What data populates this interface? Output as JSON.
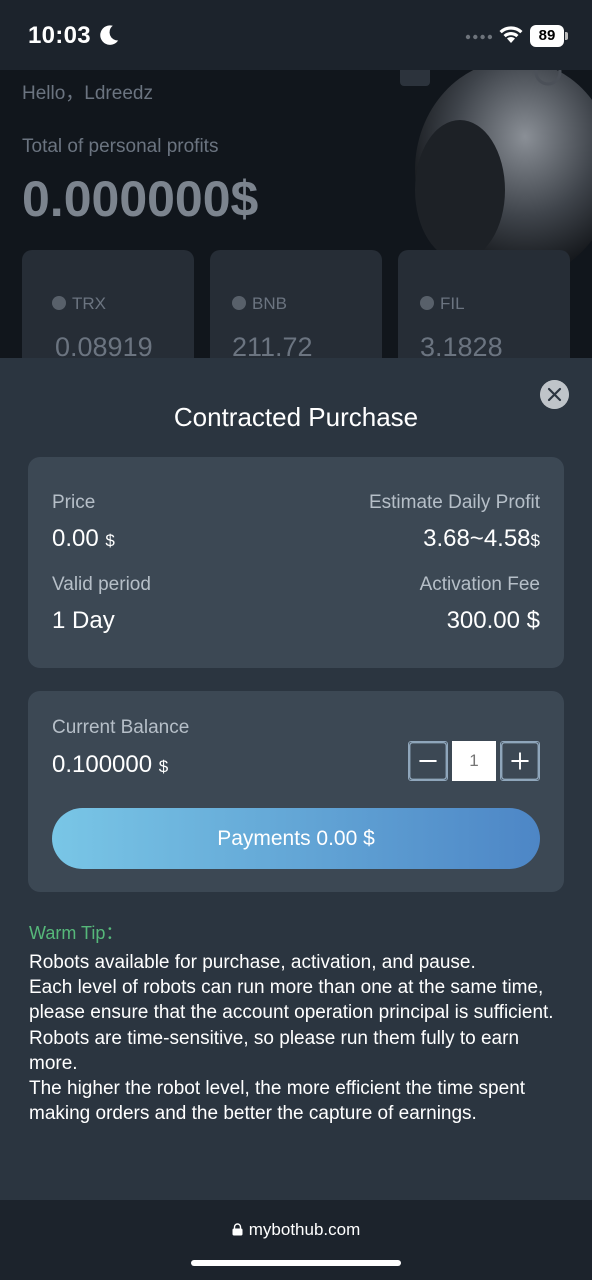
{
  "status_bar": {
    "time": "10:03",
    "battery": "89",
    "icons": [
      "moon-icon",
      "signal-dots-icon",
      "wifi-icon",
      "battery-icon"
    ]
  },
  "background_page": {
    "greeting": "Hello，Ldreedz",
    "profit_label": "Total of personal profits",
    "profit_value": "0.000000$",
    "coins": [
      {
        "name": "TRX",
        "price": "0.08919"
      },
      {
        "name": "BNB",
        "price": "211.72"
      },
      {
        "name": "FIL",
        "price": "3.1828"
      }
    ]
  },
  "modal": {
    "title": "Contracted Purchase",
    "price_label": "Price",
    "price_value": "0.00",
    "price_unit": "$",
    "daily_profit_label": "Estimate Daily Profit",
    "daily_profit_value": "3.68~4.58",
    "daily_profit_unit": "$",
    "valid_period_label": "Valid period",
    "valid_period_value": "1 Day",
    "activation_fee_label": "Activation Fee",
    "activation_fee_value": "300.00 $",
    "balance_label": "Current Balance",
    "balance_value": "0.100000",
    "balance_unit": "$",
    "quantity_placeholder": "1",
    "payment_button": "Payments 0.00 $",
    "tip_title": "Warm Tip：",
    "tip_lines": [
      "Robots available for purchase, activation, and pause.",
      "Each level of robots can run more than one at the same time, please ensure that the account operation principal is sufficient.",
      "Robots are time-sensitive, so please run them fully to earn more.",
      "The higher the robot level, the more efficient the time spent making orders and the better the capture of earnings."
    ]
  },
  "browser": {
    "url": "mybothub.com"
  },
  "colors": {
    "sheet_bg": "#2b3540",
    "card_bg": "#3c4854",
    "tip_green": "#56b87a",
    "button_gradient_start": "#79c6e6",
    "button_gradient_end": "#4d86c6"
  }
}
